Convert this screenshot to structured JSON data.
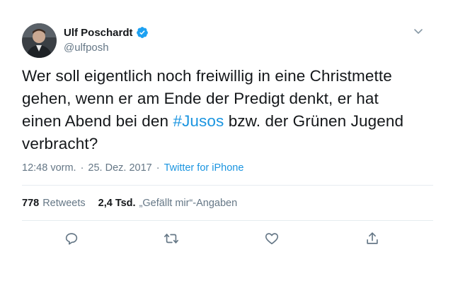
{
  "author": {
    "display_name": "Ulf Poschardt",
    "handle": "@ulfposh"
  },
  "tweet": {
    "text_parts": {
      "before": "Wer soll eigentlich noch freiwillig in eine Christmette gehen, wenn er am Ende der Predigt denkt, er hat einen Abend bei den ",
      "hashtag": "#Jusos",
      "after": " bzw. der Grünen Jugend verbracht?"
    },
    "time": "12:48 vorm.",
    "date_sep": "·",
    "date": "25. Dez. 2017",
    "source_sep": "·",
    "source": "Twitter for iPhone"
  },
  "stats": {
    "retweets_count": "778",
    "retweets_label": "Retweets",
    "likes_count": "2,4 Tsd.",
    "likes_label": "„Gefällt mir“-Angaben"
  },
  "colors": {
    "link": "#1b95e0",
    "secondary_text": "#657786",
    "verified": "#1da1f2"
  },
  "icons": {
    "caret": "chevron-down-icon",
    "reply": "reply-icon",
    "retweet": "retweet-icon",
    "like": "heart-icon",
    "share": "share-icon",
    "verified": "verified-badge-icon"
  }
}
